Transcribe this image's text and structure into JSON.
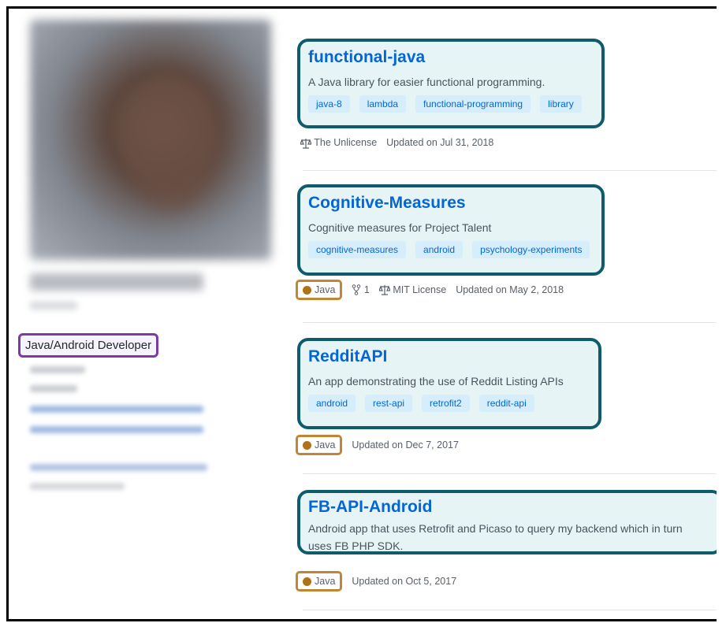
{
  "profile": {
    "bio": "Java/Android Developer"
  },
  "repos": [
    {
      "name": "functional-java",
      "description": "A Java library for easier functional programming.",
      "topics": [
        "java-8",
        "lambda",
        "functional-programming",
        "library"
      ],
      "language": "",
      "forks": "",
      "license": "The Unlicense",
      "updated": "Updated on Jul 31, 2018"
    },
    {
      "name": "Cognitive-Measures",
      "description": "Cognitive measures for Project Talent",
      "topics": [
        "cognitive-measures",
        "android",
        "psychology-experiments"
      ],
      "language": "Java",
      "forks": "1",
      "license": "MIT License",
      "updated": "Updated on May 2, 2018"
    },
    {
      "name": "RedditAPI",
      "description": "An app demonstrating the use of Reddit Listing APIs",
      "topics": [
        "android",
        "rest-api",
        "retrofit2",
        "reddit-api"
      ],
      "language": "Java",
      "updated": "Updated on Dec 7, 2017"
    },
    {
      "name": "FB-API-Android",
      "description_line1": "Android app that uses Retrofit and Picaso to query my backend which in turn",
      "description_line2": "uses FB PHP SDK.",
      "language": "Java",
      "updated": "Updated on Oct 5, 2017"
    }
  ],
  "colors": {
    "repo_highlight": "#0d5b6b",
    "language_highlight": "#c28533",
    "bio_highlight": "#7c3aa4",
    "java_color": "#b07219",
    "link": "#0366d6"
  }
}
